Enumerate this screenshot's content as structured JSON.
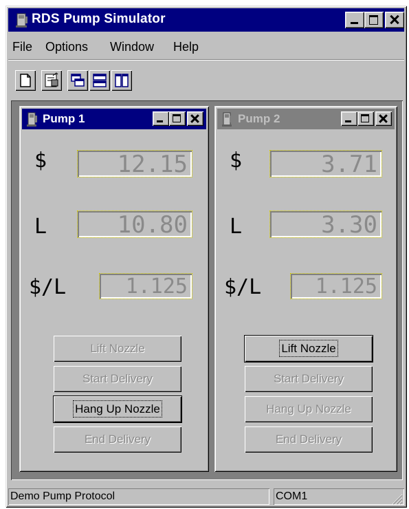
{
  "app": {
    "title": "RDS Pump Simulator",
    "icon": "pump-icon"
  },
  "menu": {
    "items": [
      "File",
      "Options",
      "Window",
      "Help"
    ]
  },
  "toolbar": {
    "buttons": [
      "new-document-icon",
      "properties-icon",
      "cascade-icon",
      "tile-horizontal-icon",
      "tile-vertical-icon"
    ]
  },
  "pumps": [
    {
      "title": "Pump 1",
      "active": true,
      "amount_label": "$",
      "amount": "12.15",
      "volume_label": "L",
      "volume": "10.80",
      "price_label": "$/L",
      "price": "1.125",
      "buttons": {
        "lift": "Lift Nozzle",
        "start": "Start Delivery",
        "hang": "Hang Up Nozzle",
        "end": "End Delivery"
      }
    },
    {
      "title": "Pump 2",
      "active": false,
      "amount_label": "$",
      "amount": "3.71",
      "volume_label": "L",
      "volume": "3.30",
      "price_label": "$/L",
      "price": "1.125",
      "buttons": {
        "lift": "Lift Nozzle",
        "start": "Start Delivery",
        "hang": "Hang Up Nozzle",
        "end": "End Delivery"
      }
    }
  ],
  "status": {
    "protocol": "Demo Pump Protocol",
    "port": "COM1"
  },
  "colors": {
    "active_title": "#000080",
    "inactive_title": "#808080",
    "face": "#c0c0c0"
  }
}
